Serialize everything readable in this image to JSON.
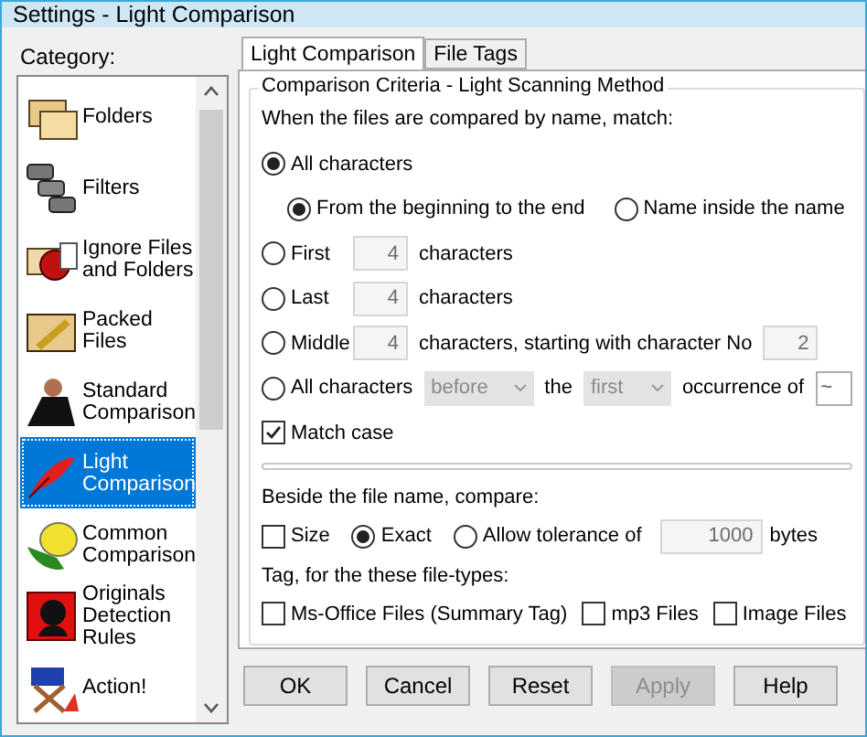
{
  "window": {
    "title": "Settings - Light Comparison"
  },
  "category": {
    "label": "Category:",
    "items": [
      {
        "label": "Folders",
        "selected": false
      },
      {
        "label": "Filters",
        "selected": false
      },
      {
        "label": "Ignore Files and Folders",
        "selected": false
      },
      {
        "label": "Packed Files",
        "selected": false
      },
      {
        "label": "Standard Comparison",
        "selected": false
      },
      {
        "label": "Light Comparison",
        "selected": true
      },
      {
        "label": "Common Comparison",
        "selected": false
      },
      {
        "label": "Originals Detection Rules",
        "selected": false
      },
      {
        "label": "Action!",
        "selected": false
      }
    ]
  },
  "tabs": [
    {
      "label": "Light Comparison",
      "selected": true
    },
    {
      "label": "File Tags",
      "selected": false
    }
  ],
  "criteria": {
    "title": "Comparison Criteria - Light Scanning Method",
    "prompt": "When the files are compared by name, match:",
    "modes": [
      {
        "kind": "plain",
        "label": "All characters",
        "selected": true
      },
      {
        "kind": "count",
        "label": "First",
        "selected": false,
        "count": "4",
        "unit": "characters"
      },
      {
        "kind": "count",
        "label": "Last",
        "selected": false,
        "count": "4",
        "unit": "characters"
      },
      {
        "kind": "range",
        "label": "Middle",
        "selected": false,
        "count": "4",
        "unit": "characters, starting with character No",
        "start": "2"
      },
      {
        "kind": "occurrence",
        "label": "All characters",
        "selected": false,
        "direction": "before",
        "joiner": "the",
        "which": "first",
        "suffix": "occurrence of",
        "char": "~"
      }
    ],
    "positions": [
      {
        "label": "From the beginning to the end",
        "selected": true
      },
      {
        "label": "Name inside the name",
        "selected": false
      }
    ],
    "match_case": {
      "label": "Match case",
      "checked": true
    }
  },
  "compare": {
    "prompt": "Beside the file name, compare:",
    "size": {
      "label": "Size",
      "checked": false
    },
    "modes": [
      {
        "label": "Exact",
        "selected": true
      },
      {
        "label": "Allow tolerance of",
        "selected": false
      }
    ],
    "tolerance": "1000",
    "unit": "bytes"
  },
  "tags": {
    "prompt": "Tag, for the these file-types:",
    "items": [
      {
        "label": "Ms-Office Files (Summary Tag)",
        "checked": false
      },
      {
        "label": "mp3 Files",
        "checked": false
      },
      {
        "label": "Image Files",
        "checked": false
      }
    ]
  },
  "buttons": [
    {
      "label": "OK",
      "disabled": false
    },
    {
      "label": "Cancel",
      "disabled": false
    },
    {
      "label": "Reset",
      "disabled": false
    },
    {
      "label": "Apply",
      "disabled": true
    },
    {
      "label": "Help",
      "disabled": false
    }
  ]
}
